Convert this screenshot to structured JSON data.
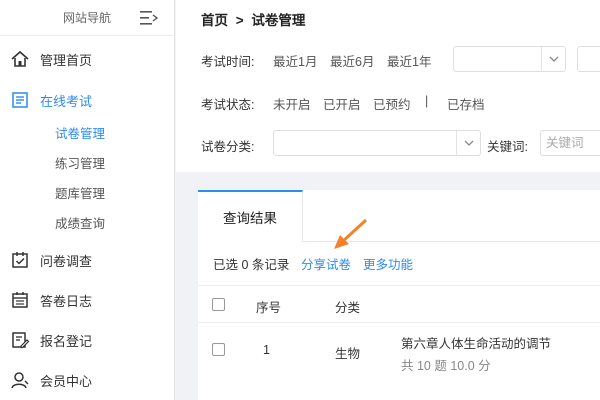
{
  "sidebar": {
    "title": "网站导航",
    "items": [
      {
        "label": "管理首页",
        "icon": "home-icon"
      },
      {
        "label": "在线考试",
        "icon": "exam-icon"
      },
      {
        "label": "问卷调查",
        "icon": "survey-icon"
      },
      {
        "label": "答卷日志",
        "icon": "log-icon"
      },
      {
        "label": "报名登记",
        "icon": "register-icon"
      },
      {
        "label": "会员中心",
        "icon": "user-icon"
      }
    ],
    "subitems": [
      "试卷管理",
      "练习管理",
      "题库管理",
      "成绩查询"
    ]
  },
  "breadcrumb": {
    "home": "首页",
    "sep": ">",
    "current": "试卷管理"
  },
  "filters": {
    "time_label": "考试时间:",
    "time_options": [
      "最近1月",
      "最近6月",
      "最近1年"
    ],
    "status_label": "考试状态:",
    "status_options": [
      "未开启",
      "已开启",
      "已预约",
      "|",
      "已存档"
    ],
    "category_label": "试卷分类:",
    "keyword_label": "关键词:",
    "keyword_placeholder": "关键词"
  },
  "results": {
    "tab_label": "查询结果",
    "selected_text": "已选 0 条记录",
    "share_label": "分享试卷",
    "more_label": "更多功能",
    "columns": [
      "序号",
      "分类"
    ],
    "rows": [
      {
        "index": "1",
        "category": "生物",
        "title": "第六章人体生命活动的调节",
        "meta": "共 10 题 10.0 分"
      }
    ]
  },
  "colors": {
    "accent": "#2d8cf0",
    "annotation_arrow": "#f5812b"
  }
}
